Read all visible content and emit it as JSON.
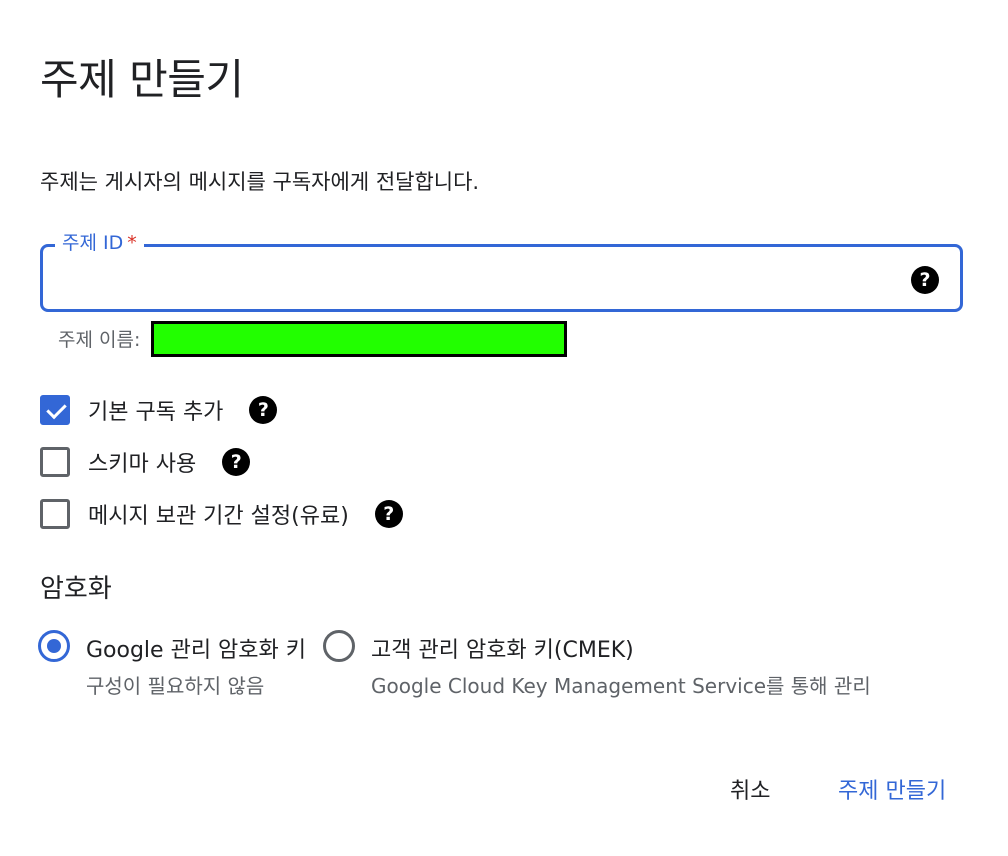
{
  "dialog": {
    "title": "주제 만들기",
    "description": "주제는 게시자의 메시지를 구독자에게 전달합니다."
  },
  "topic_id_field": {
    "label": "주제 ID",
    "required_marker": "*",
    "value": "",
    "hint_prefix": "주제 이름:"
  },
  "options": [
    {
      "label": "기본 구독 추가",
      "checked": true
    },
    {
      "label": "스키마 사용",
      "checked": false
    },
    {
      "label": "메시지 보관 기간 설정(유료)",
      "checked": false
    }
  ],
  "encryption": {
    "heading": "암호화",
    "options": [
      {
        "label": "Google 관리 암호화 키",
        "sub": "구성이 필요하지 않음",
        "selected": true
      },
      {
        "label": "고객 관리 암호화 키(CMEK)",
        "sub": "Google Cloud Key Management Service를 통해 관리",
        "selected": false
      }
    ]
  },
  "buttons": {
    "cancel": "취소",
    "create": "주제 만들기"
  },
  "icons": {
    "help": "?"
  },
  "colors": {
    "accent": "#3367d6",
    "required": "#d93025",
    "redaction": "#22ff00"
  }
}
